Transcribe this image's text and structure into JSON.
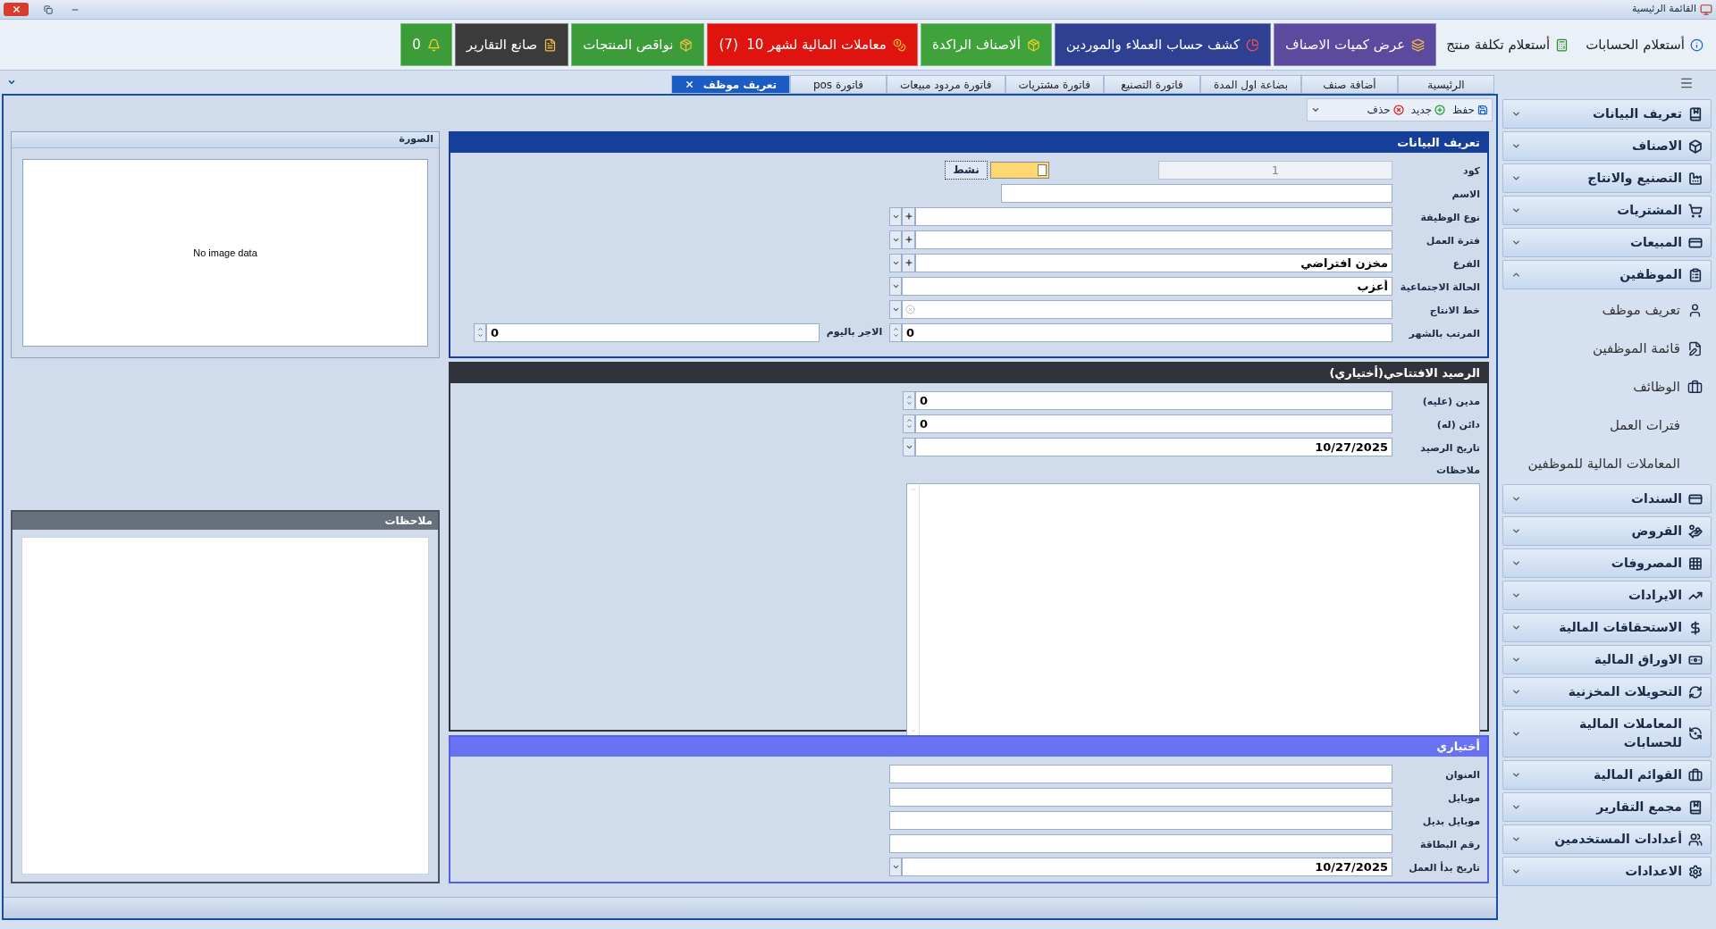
{
  "window": {
    "title": "القائمة الرئيسية"
  },
  "toolbar": {
    "buttons": [
      {
        "kind": "plain",
        "label": "أستعلام الحسابات"
      },
      {
        "kind": "plain",
        "label": "أستعلام تكلفة منتج"
      },
      {
        "kind": "tile",
        "label": "عرض كميات الاصناف",
        "color": "#5b4a9e"
      },
      {
        "kind": "tile",
        "label": "كشف حساب العملاء والموردين",
        "color": "#2f3f92"
      },
      {
        "kind": "tile",
        "label": "ألاصناف الراكدة",
        "color": "#3fa23b"
      },
      {
        "kind": "tile",
        "label": "معاملات المالية لشهر 10  (7)",
        "color": "#e0140f"
      },
      {
        "kind": "tile",
        "label": "نواقص المنتجات",
        "color": "#3c9c3a"
      },
      {
        "kind": "tile",
        "label": "صانع التقارير",
        "color": "#3b3b3b"
      },
      {
        "kind": "tile",
        "label": "0",
        "color": "#3c9c3a"
      }
    ]
  },
  "tabs": [
    {
      "label": "الرئيسية",
      "selected": false
    },
    {
      "label": "أضافة صنف",
      "selected": false
    },
    {
      "label": "بضاعة اول المدة",
      "selected": false
    },
    {
      "label": "فاتورة التصنيع",
      "selected": false
    },
    {
      "label": "فاتورة مشتريات",
      "selected": false
    },
    {
      "label": "فاتورة مردود مبيعات",
      "selected": false
    },
    {
      "label": "فاتورة pos",
      "selected": false
    },
    {
      "label": "تعريف موظف",
      "selected": true
    }
  ],
  "actions": [
    "حفظ",
    "جديد",
    "حذف"
  ],
  "data_panel": {
    "title": "تعريف البيانات",
    "fields": [
      {
        "kind": "code",
        "label": "كود",
        "value": "1",
        "toggle": {
          "label": "نشط",
          "on": false
        }
      },
      {
        "kind": "text",
        "label": "الاسم"
      },
      {
        "kind": "combo_add",
        "label": "نوع الوظيفة"
      },
      {
        "kind": "combo_add",
        "label": "فترة العمل"
      },
      {
        "kind": "combo_add",
        "label": "الفرع",
        "value": "مخزن افتراضي"
      },
      {
        "kind": "combo",
        "label": "الحالة الاجتماعية",
        "value": "أعزب"
      },
      {
        "kind": "combo_clear",
        "label": "خط الانتاج"
      },
      {
        "kind": "spin_pair",
        "label": "المرتب بالشهر",
        "value": "0",
        "second": {
          "label": "الاجر باليوم",
          "value": "0"
        }
      }
    ]
  },
  "opening_balance": {
    "title": "الرصيد الافتتاحي(أختياري)",
    "fields": [
      {
        "kind": "spin",
        "label": "مدين (عليه)",
        "value": "0"
      },
      {
        "kind": "spin",
        "label": "دائن (له)",
        "value": "0"
      },
      {
        "kind": "date",
        "label": "تاريخ الرصيد",
        "value": "10/27/2025"
      },
      {
        "kind": "memo",
        "label": "ملاحظات"
      }
    ]
  },
  "optional": {
    "title": "أختياري",
    "fields": [
      {
        "kind": "text",
        "label": "العنوان"
      },
      {
        "kind": "text",
        "label": "موبايل"
      },
      {
        "kind": "text",
        "label": "موبايل بديل"
      },
      {
        "kind": "text",
        "label": "رقم البطاقة"
      },
      {
        "kind": "date",
        "label": "تاريخ بدأ العمل",
        "value": "10/27/2025"
      }
    ]
  },
  "image_panel": {
    "title": "الصورة",
    "placeholder": "No image data"
  },
  "notes_panel": {
    "title": "ملاحظات"
  },
  "sidebar": {
    "groups": [
      {
        "label": "تعريف البيانات",
        "expanded": false
      },
      {
        "label": "الاصناف",
        "expanded": false
      },
      {
        "label": "التصنيع والانتاج",
        "expanded": false
      },
      {
        "label": "المشتريات",
        "expanded": false
      },
      {
        "label": "المبيعات",
        "expanded": false
      },
      {
        "label": "الموظفين",
        "expanded": true,
        "children": [
          {
            "label": "تعريف موظف"
          },
          {
            "label": "قائمة الموظفين"
          },
          {
            "label": "الوظائف"
          },
          {
            "label": "فترات العمل"
          },
          {
            "label": "المعاملات المالية للموظفين"
          }
        ]
      },
      {
        "label": "السندات",
        "expanded": false
      },
      {
        "label": "القروض",
        "expanded": false
      },
      {
        "label": "المصروفات",
        "expanded": false
      },
      {
        "label": "الايرادات",
        "expanded": false
      },
      {
        "label": "الاستحقاقات المالية",
        "expanded": false
      },
      {
        "label": "الاوراق المالية",
        "expanded": false
      },
      {
        "label": "التحويلات المخزنية",
        "expanded": false
      },
      {
        "label": "المعاملات المالية للحسابات",
        "expanded": false
      },
      {
        "label": "القوائم المالية",
        "expanded": false
      },
      {
        "label": "مجمع التقارير",
        "expanded": false
      },
      {
        "label": "أعدادات المستخدمين",
        "expanded": false
      },
      {
        "label": "الاعدادات",
        "expanded": false
      }
    ]
  }
}
